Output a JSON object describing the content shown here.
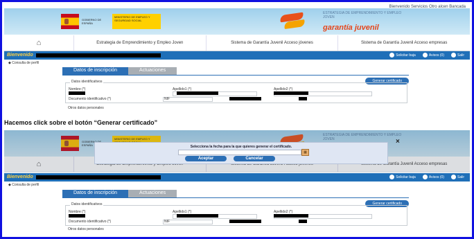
{
  "header": {
    "top_links": "Bienvenido  Servicios  Otro alcen  Bancada",
    "gov_text": "GOBIERNO DE ESPAÑA",
    "ministry_text": "MINISTERIO DE EMPLEO Y SEGURIDAD SOCIAL",
    "gj_small": "ESTRATEGIA DE EMPRENDIMIENTO Y EMPLEO JOVEN",
    "gj_big": "garantía juvenil"
  },
  "nav": {
    "home_icon": "home-icon",
    "items": [
      "Estrategia de Emprendimiento y Empleo Joven",
      "Sistema de Garantía Juvenil Acceso jóvenes",
      "Sistema de Garantía Juvenil Acceso empresas"
    ]
  },
  "bar": {
    "welcome": "Bienvenido",
    "right_items": [
      "Solicitar baja",
      "Avisos (0)",
      "Salir"
    ]
  },
  "breadcrumb": "Consulta de perfil",
  "tabs": [
    "Datos de inscripción",
    "Actuaciones"
  ],
  "form": {
    "generate_button": "Generar certificado",
    "legend": "Datos identificativos",
    "nombre": "Nombre (*)",
    "apellido1": "Apellido1 (*)",
    "apellido2": "Apellido2 (*)",
    "documento": "Documento identificativo (*)",
    "nif": "NIF",
    "otros": "Otros datos personales"
  },
  "caption": "Hacemos click sobre el botón “Generar certificado”",
  "dialog": {
    "title": "Selecciona la fecha para la que quieres generar el certificado.",
    "accept": "Aceptar",
    "cancel": "Cancelar",
    "close": "×"
  },
  "colors": {
    "frame_border": "#1010e0",
    "bar_blue": "#1f6fb8",
    "accent_orange": "#e5451b"
  }
}
